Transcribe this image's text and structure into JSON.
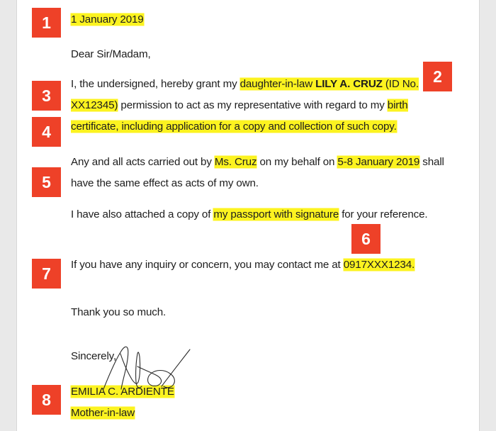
{
  "document": {
    "type": "authorization-letter",
    "date": "1 January 2019",
    "salutation": "Dear Sir/Madam,",
    "grant_paragraph": {
      "lead": "I, the undersigned, hereby grant my ",
      "relation": "daughter-in-law ",
      "representative_name": "LILY A. CRUZ",
      "id_clause": " (ID No. XX12345)",
      "middle": " permission to act as my representative with regard to my ",
      "purpose": "birth certificate, including application for a copy and collection of such copy."
    },
    "acts_paragraph": {
      "lead": "Any and all acts carried out by ",
      "representative_short": "Ms. Cruz",
      "middle": " on my behalf on ",
      "date_range": "5-8 January 2019",
      "tail": " shall have the same effect as acts of my own."
    },
    "attachment_paragraph": {
      "lead": "I have also attached a copy of ",
      "attachment": "my passport with signature",
      "tail": " for your reference."
    },
    "contact_paragraph": {
      "lead": "If you have any inquiry or concern, you may contact me at ",
      "phone": "0917XXX1234."
    },
    "thanks": "Thank you so much.",
    "closing": "Sincerely,",
    "signer": {
      "name": "EMILIA C. ARDIENTE",
      "title": "Mother-in-law",
      "signature_icon": "handwritten-signature-icon"
    }
  },
  "annotations": {
    "badges": [
      {
        "number": "1",
        "target": "date"
      },
      {
        "number": "2",
        "target": "representative-name"
      },
      {
        "number": "3",
        "target": "representative-id"
      },
      {
        "number": "4",
        "target": "purpose-of-authorization"
      },
      {
        "number": "5",
        "target": "validity-dates"
      },
      {
        "number": "6",
        "target": "attachment"
      },
      {
        "number": "7",
        "target": "contact-number"
      },
      {
        "number": "8",
        "target": "signature-block"
      }
    ]
  },
  "colors": {
    "badge_background": "#EE4128",
    "badge_text": "#FFFFFF",
    "highlight": "#FCF320",
    "page_background": "#FFFFFF",
    "canvas_background": "#E9E9E9",
    "body_text": "#1D1D1D"
  }
}
